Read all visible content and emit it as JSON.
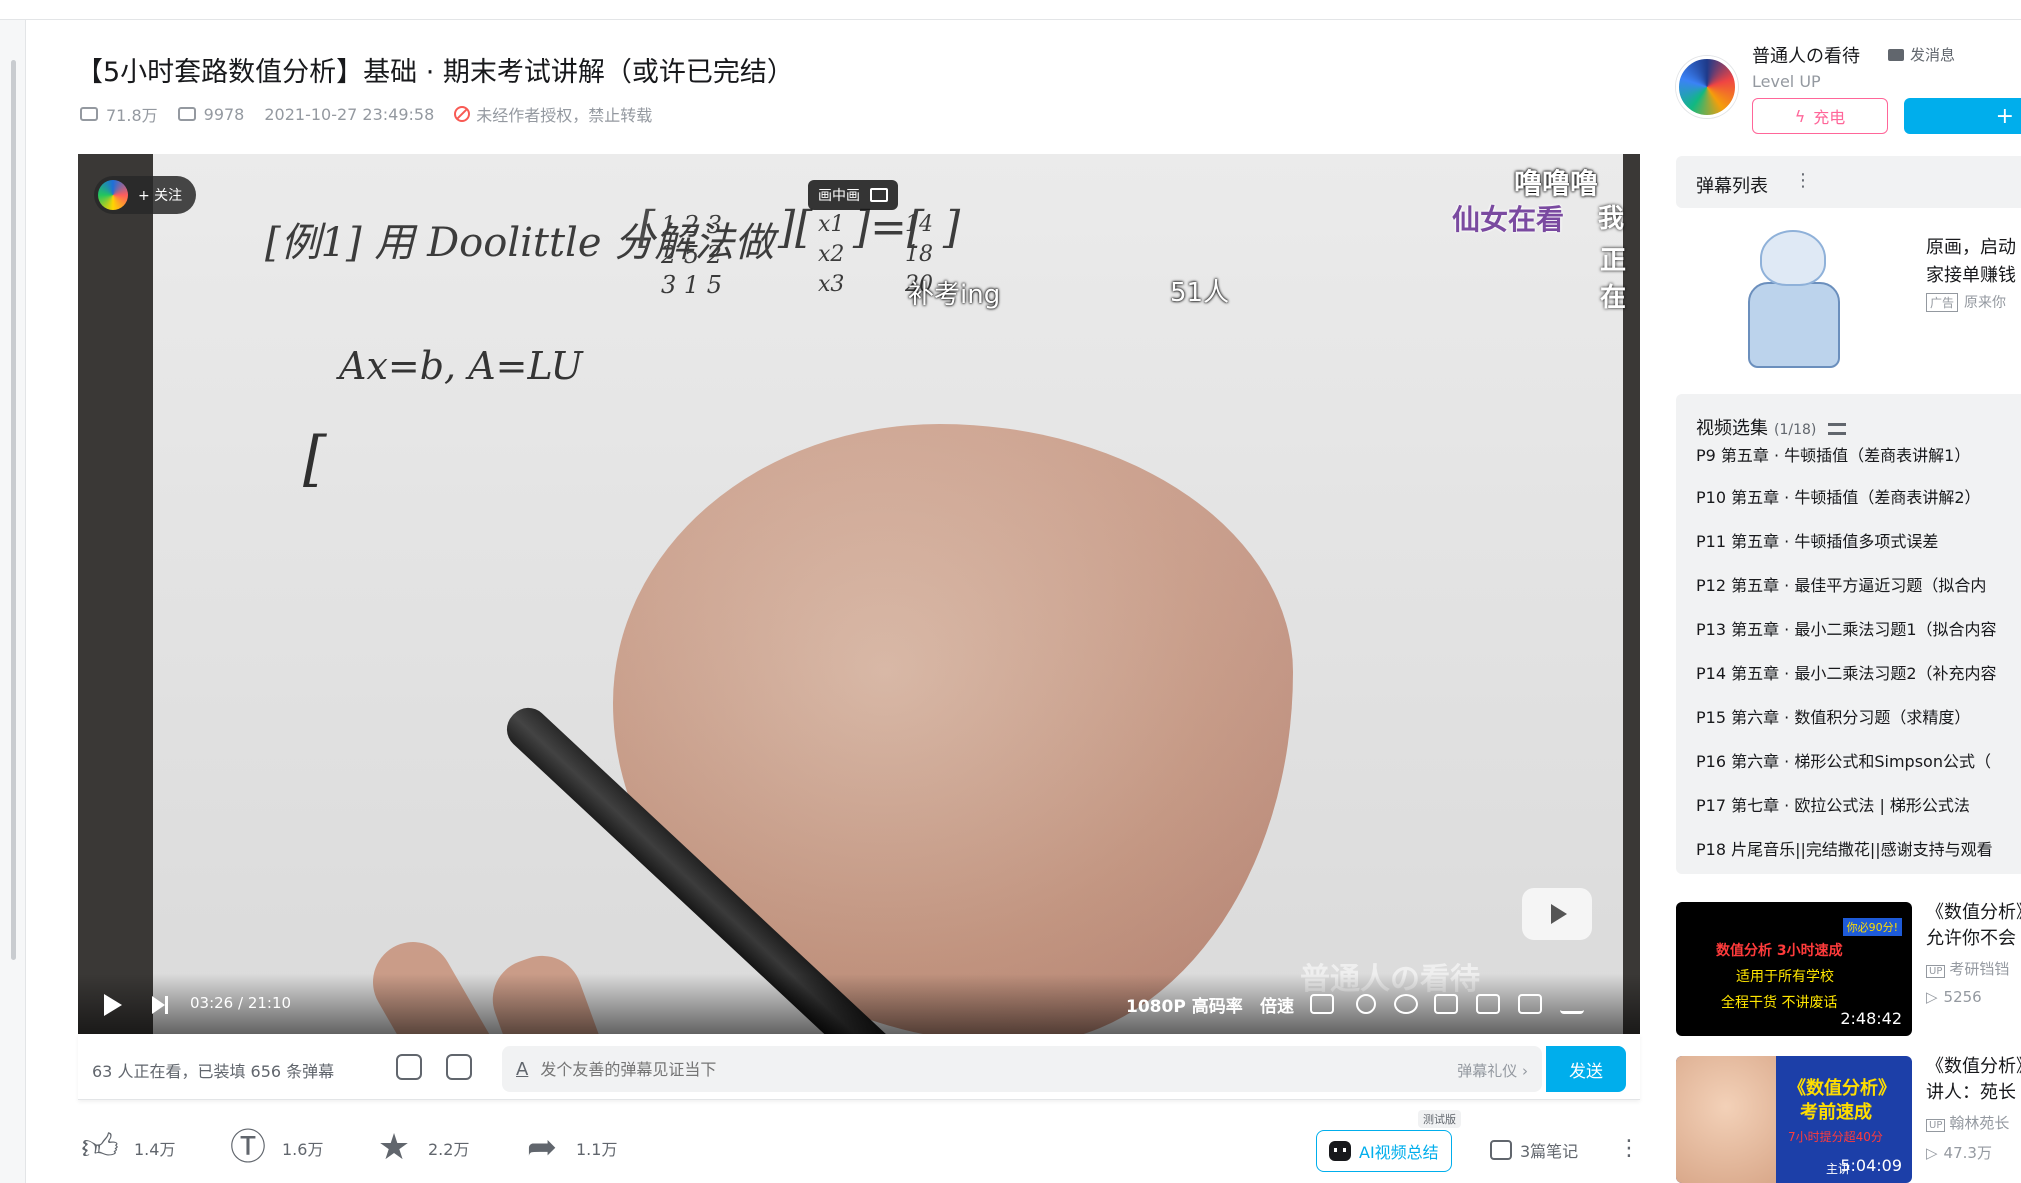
{
  "video": {
    "title": "【5小时套路数值分析】基础 · 期末考试讲解（或许已完结）",
    "views": "71.8万",
    "danmaku_count": "9978",
    "date": "2021-10-27 23:49:58",
    "copyright": "未经作者授权，禁止转载"
  },
  "player": {
    "follow_label": "+ 关注",
    "pip_label": "画中画",
    "danmaku": [
      "补考ing",
      "51人",
      "噜噜噜",
      "仙女在看",
      "我",
      "正在"
    ],
    "board": {
      "line1": "[例1] 用 Doolittle 分解法做",
      "matrix_rows": [
        "1   2   3",
        "2   5   2",
        "3   1   5"
      ],
      "vector_x": [
        "x1",
        "x2",
        "x3"
      ],
      "vector_b": [
        "14",
        "18",
        "20"
      ],
      "line2": "Ax=b,   A=LU"
    },
    "watermark": "普通人の看待",
    "time": "03:26 / 21:10",
    "quality": "1080P 高码率",
    "speed": "倍速"
  },
  "danmaku_bar": {
    "status": "63 人正在看，已装填 656 条弹幕",
    "placeholder": "发个友善的弹幕见证当下",
    "etiquette": "弹幕礼仪 ›",
    "send": "发送"
  },
  "actions": {
    "like": "1.4万",
    "coin": "1.6万",
    "favorite": "2.2万",
    "share": "1.1万",
    "ai_summary": "AI视频总结",
    "trial": "测试版",
    "notes": "3篇笔记"
  },
  "uploader": {
    "name": "普通人の看待",
    "message": "发消息",
    "level": "Level UP",
    "charge": "充电",
    "follow": "+"
  },
  "danmaku_list": {
    "label": "弹幕列表",
    "more": "⋮"
  },
  "ad": {
    "line1": "原画，启动",
    "line2": "家接单赚钱",
    "tag": "广告",
    "source": "原来你"
  },
  "episodes": {
    "title": "视频选集",
    "count": "(1/18)",
    "items": [
      "P9   第五章 · 牛顿插值（差商表讲解1）",
      "P10   第五章 · 牛顿插值（差商表讲解2）",
      "P11   第五章 · 牛顿插值多项式误差",
      "P12   第五章 · 最佳平方逼近习题（拟合内",
      "P13   第五章 · 最小二乘法习题1（拟合内容",
      "P14   第五章 · 最小二乘法习题2（补充内容",
      "P15   第六章 · 数值积分习题（求精度）",
      "P16   第六章 · 梯形公式和Simpson公式（",
      "P17   第七章 · 欧拉公式法 | 梯形公式法",
      "P18   片尾音乐||完结撒花||感谢支持与观看"
    ]
  },
  "recommendations": [
    {
      "title1": "《数值分析》",
      "title2": "允许你不会",
      "up": "考研铛铛",
      "views": "5256",
      "duration": "2:48:42",
      "thumb_lines": [
        "数值分析 3小时速成",
        "适用于所有学校",
        "全程干货 不讲废话"
      ],
      "thumb_badge": "你必90分!"
    },
    {
      "title1": "《数值分析》",
      "title2": "讲人：苑长",
      "up": "翰林苑长",
      "views": "47.3万",
      "duration": "5:04:09",
      "thumb_lines": [
        "《数值分析》",
        "考前速成",
        "7小时提分超40分"
      ],
      "thumb_badge": "主讲"
    }
  ],
  "colors": {
    "accent": "#00aeec",
    "charge": "#ff6699",
    "text": "#18191c",
    "muted": "#9499a0"
  }
}
